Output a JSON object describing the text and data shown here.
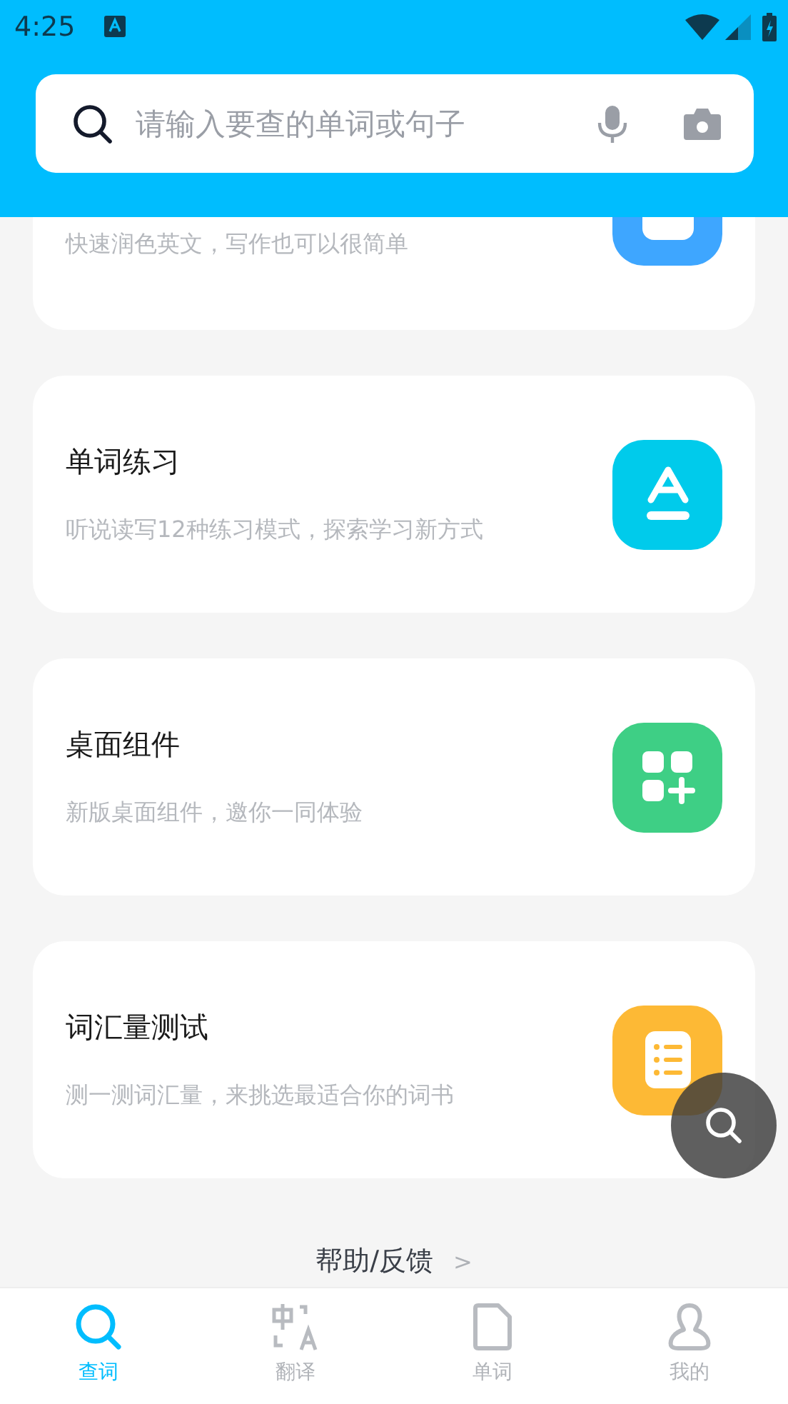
{
  "status_bar": {
    "time": "4:25"
  },
  "search": {
    "placeholder": "请输入要查的单词或句子"
  },
  "cards": [
    {
      "kind": "partial",
      "subtitle": "快速润色英文，写作也可以很简单",
      "color": "#3ea6ff"
    },
    {
      "kind": "full",
      "title": "单词练习",
      "subtitle": "听说读写12种练习模式，探索学习新方式",
      "color": "#00cbeb"
    },
    {
      "kind": "full",
      "title": "桌面组件",
      "subtitle": "新版桌面组件，邀你一同体验",
      "color": "#3ecf85"
    },
    {
      "kind": "full",
      "title": "词汇量测试",
      "subtitle": "测一测词汇量，来挑选最适合你的词书",
      "color": "#fdb935"
    }
  ],
  "help": {
    "label": "帮助/反馈",
    "arrow": ">"
  },
  "nav": [
    {
      "label": "查词",
      "selected": true
    },
    {
      "label": "翻译",
      "selected": false
    },
    {
      "label": "单词",
      "selected": false
    },
    {
      "label": "我的",
      "selected": false
    }
  ]
}
